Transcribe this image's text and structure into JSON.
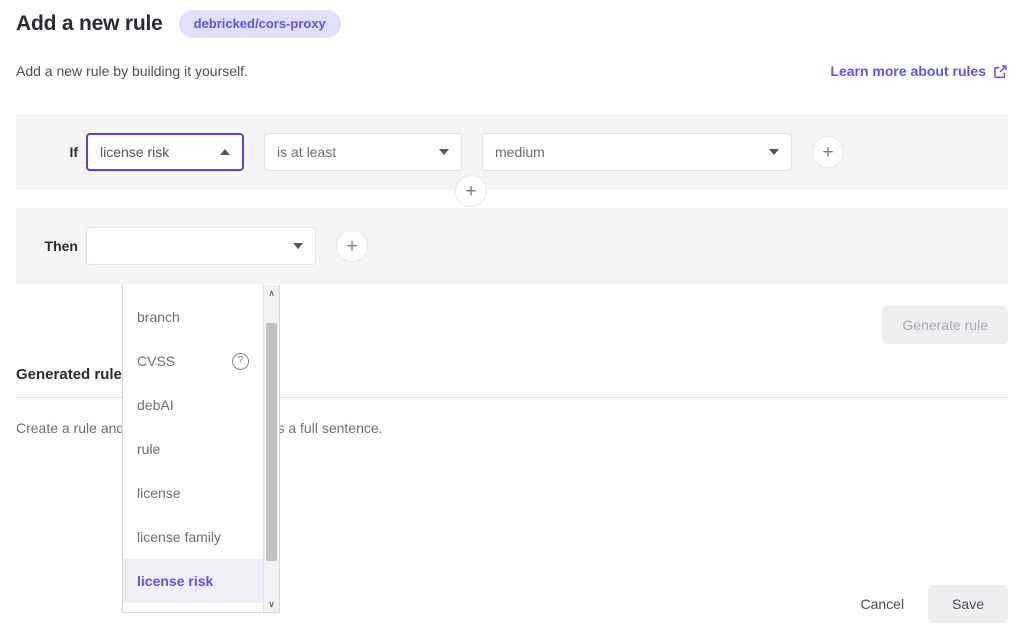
{
  "header": {
    "title": "Add a new rule",
    "repo_badge": "debricked/cors-proxy",
    "subtitle": "Add a new rule by building it yourself.",
    "learn_link": "Learn more about rules",
    "external_link_icon": "external-link-icon"
  },
  "builder": {
    "if_label": "If",
    "then_label": "Then",
    "if_attribute_value": "license risk",
    "if_operator_value": "is at least",
    "if_value_value": "medium",
    "then_value": "",
    "add_icon": "+",
    "attribute_dropdown": {
      "open": true,
      "options": [
        {
          "label": "branch",
          "help": false
        },
        {
          "label": "CVSS",
          "help": true
        },
        {
          "label": "debAI",
          "help": false
        },
        {
          "label": "rule",
          "help": false
        },
        {
          "label": "license",
          "help": false
        },
        {
          "label": "license family",
          "help": false
        },
        {
          "label": "license risk",
          "help": false
        }
      ],
      "selected": "license risk",
      "help_icon": "?",
      "scroll_up_icon": "∧",
      "scroll_down_icon": "∨"
    }
  },
  "generate": {
    "button_label": "Generate rule",
    "enabled": false
  },
  "generated_rule": {
    "heading": "Generated rule",
    "description": "Create a rule and we will make it appear as a full sentence."
  },
  "footer": {
    "cancel_label": "Cancel",
    "save_label": "Save"
  },
  "colors": {
    "accent": "#5b55e8",
    "focus_border": "#4f46e5",
    "row_background": "#f5f5f6",
    "badge_background": "#e1dffb"
  }
}
